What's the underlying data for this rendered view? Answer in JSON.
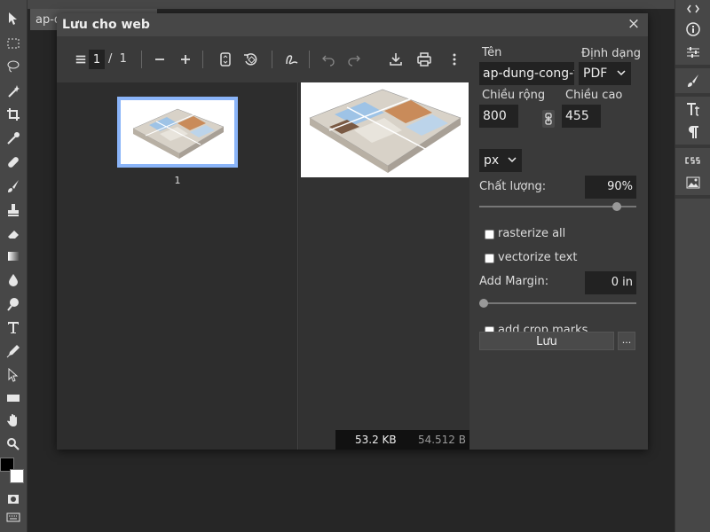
{
  "document_tab": {
    "label": "ap-d"
  },
  "dialog": {
    "title": "Lưu cho web",
    "close": "×"
  },
  "pdf_toolbar": {
    "page_current": "1",
    "page_separator": "/",
    "page_total": "1"
  },
  "thumbnails": [
    {
      "number": "1"
    }
  ],
  "file_size": {
    "kb": "53.2 KB",
    "bytes": "54.512 B"
  },
  "settings": {
    "name_label": "Tên",
    "name_value": "ap-dung-cong-th",
    "format_label": "Định dạng",
    "format_value": "PDF",
    "width_label": "Chiều rộng",
    "width_value": "800",
    "height_label": "Chiều cao",
    "height_value": "455",
    "unit_value": "px",
    "quality_label": "Chất lượng:",
    "quality_value": "90%",
    "quality_fraction": 0.9,
    "rasterize_label": "rasterize all",
    "vectorize_label": "vectorize text",
    "margin_label": "Add Margin:",
    "margin_value": "0 in",
    "margin_fraction": 0,
    "crop_marks_label": "add crop marks",
    "save_label": "Lưu",
    "more_label": "..."
  },
  "icons": {
    "left_tools": [
      "move-icon",
      "marquee-icon",
      "lasso-icon",
      "magic-wand-icon",
      "crop-icon",
      "eyedropper-icon",
      "healing-icon",
      "brush-icon",
      "stamp-icon",
      "eraser-icon",
      "gradient-icon",
      "blur-icon",
      "dodge-icon",
      "text-icon",
      "pen-icon",
      "path-select-icon",
      "rectangle-icon",
      "hand-icon",
      "zoom-icon"
    ],
    "right_panel": [
      "code-icon",
      "info-icon",
      "adjust-icon",
      "brush-settings-icon",
      "character-icon",
      "paragraph-icon",
      "css-icon",
      "image-icon"
    ]
  },
  "colors": {
    "accent_thumb_border": "#8ab4f8",
    "foreground": "#000000",
    "background": "#ffffff"
  }
}
